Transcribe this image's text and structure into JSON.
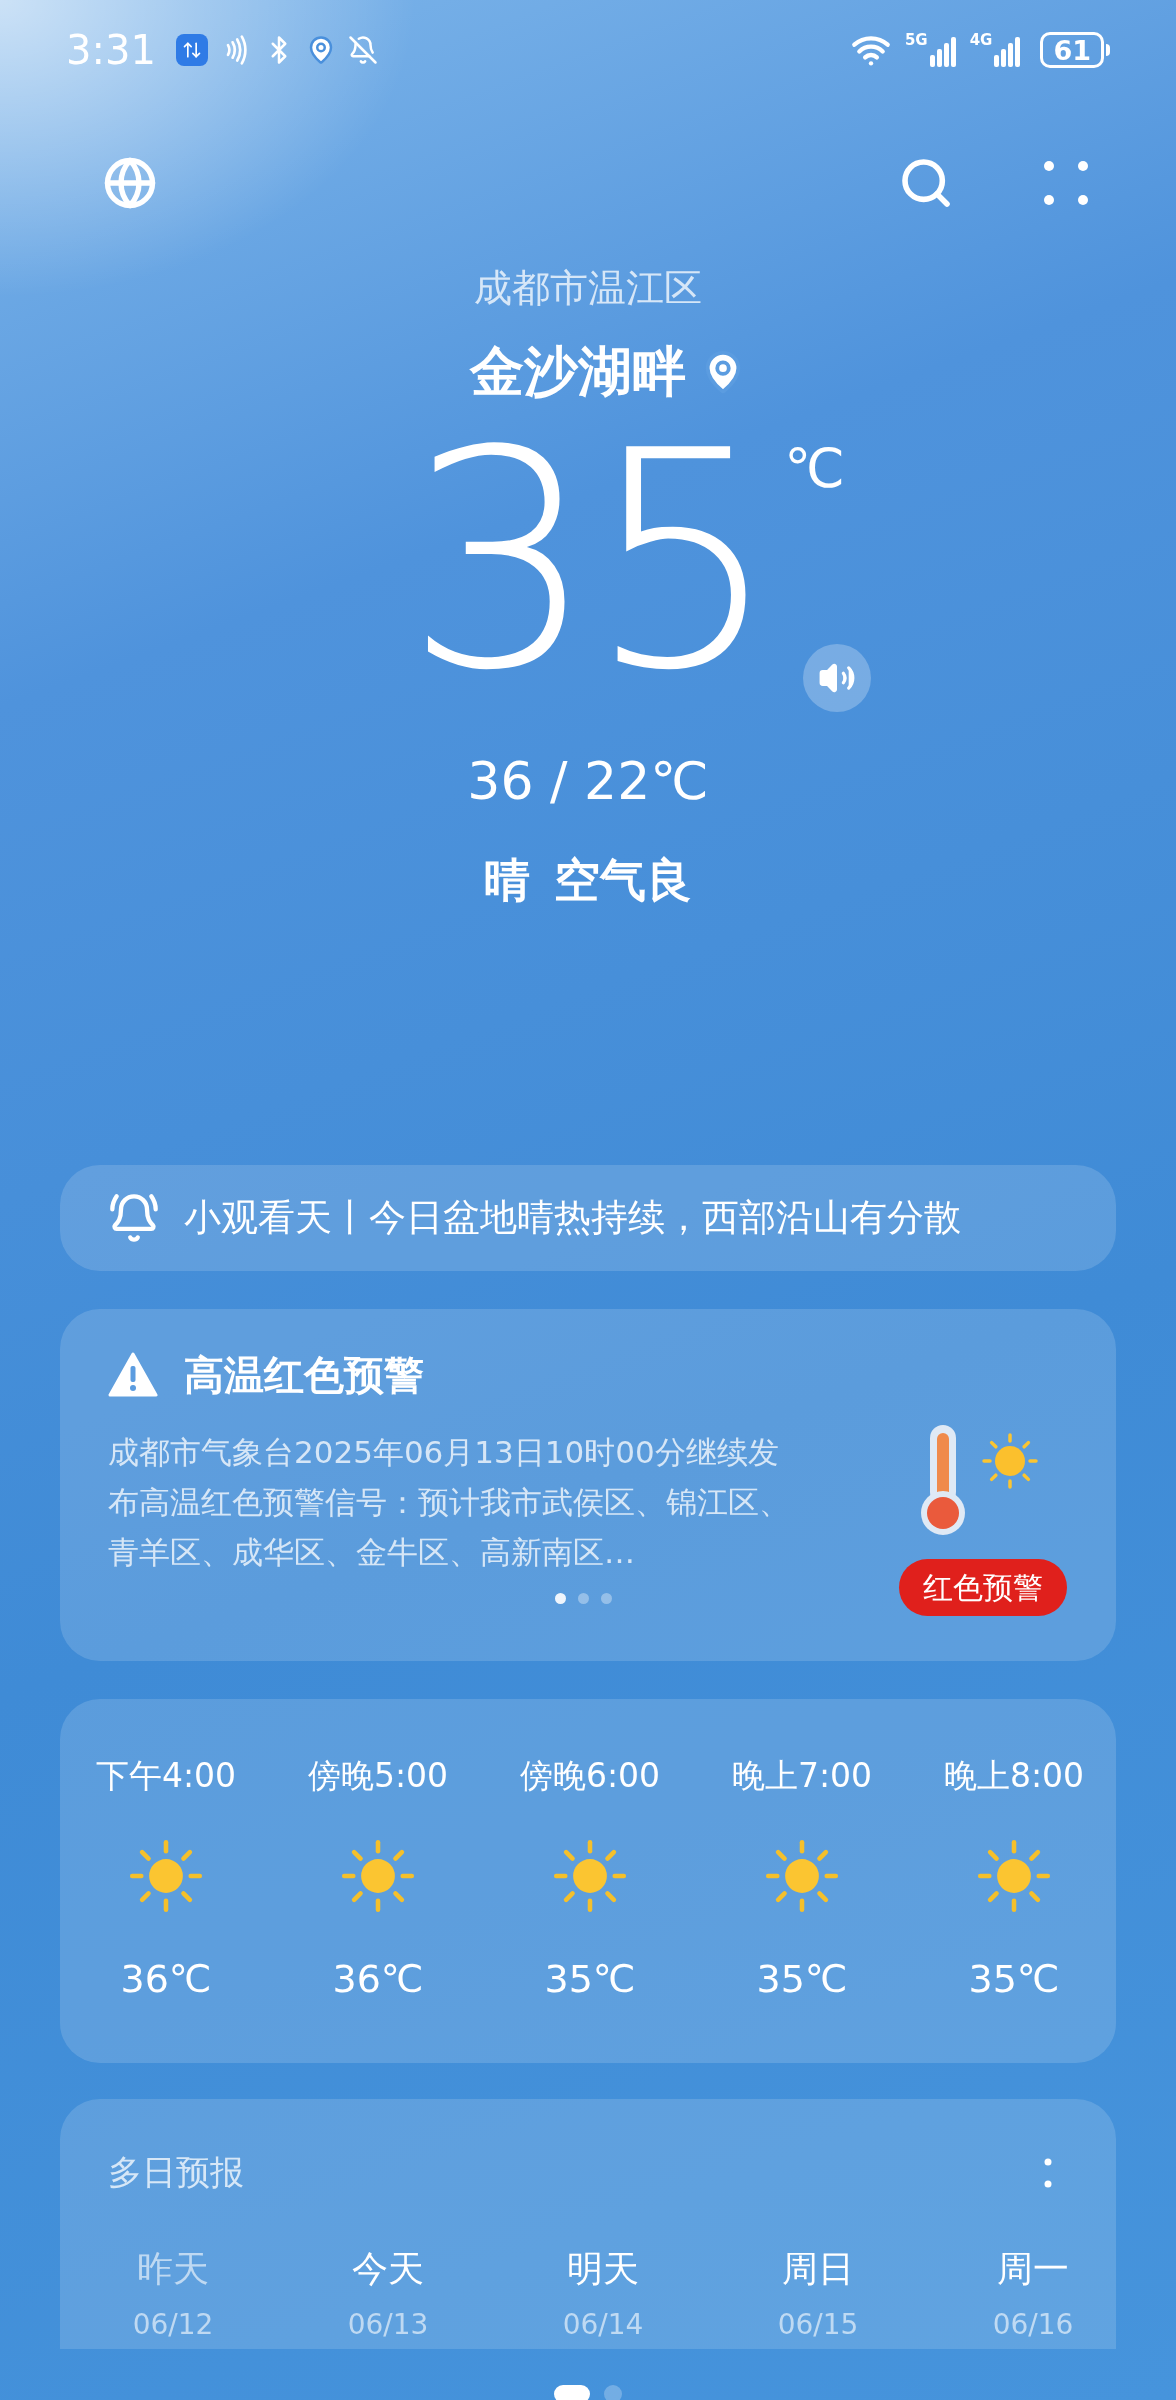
{
  "status_bar": {
    "time": "3:31",
    "networks": [
      "5G",
      "4G"
    ],
    "battery": "61"
  },
  "header": {
    "region": "成都市温江区",
    "location": "金沙湖畔",
    "temperature": "35",
    "unit": "℃",
    "range": "36 / 22℃",
    "condition": "晴",
    "air": "空气良"
  },
  "banner": {
    "text": "小观看天丨今日盆地晴热持续，西部沿山有分散"
  },
  "alert": {
    "title": "高温红色预警",
    "body": "成都市气象台2025年06月13日10时00分继续发布高温红色预警信号：预计我市武侯区、锦江区、青羊区、成华区、金牛区、高新南区…",
    "badge": "红色预警",
    "pages": [
      {
        "selected": true
      },
      {
        "selected": false
      },
      {
        "selected": false
      }
    ]
  },
  "hourly": [
    {
      "time": "下午4:00",
      "temp": "36℃"
    },
    {
      "time": "傍晚5:00",
      "temp": "36℃"
    },
    {
      "time": "傍晚6:00",
      "temp": "35℃"
    },
    {
      "time": "晚上7:00",
      "temp": "35℃"
    },
    {
      "time": "晚上8:00",
      "temp": "35℃"
    }
  ],
  "forecast": {
    "title": "多日预报",
    "days": [
      {
        "label": "昨天",
        "date": "06/12",
        "past": true
      },
      {
        "label": "今天",
        "date": "06/13",
        "past": false
      },
      {
        "label": "明天",
        "date": "06/14",
        "past": false
      },
      {
        "label": "周日",
        "date": "06/15",
        "past": false
      },
      {
        "label": "周一",
        "date": "06/16",
        "past": false
      }
    ]
  },
  "page_indicator": [
    {
      "selected": true
    },
    {
      "selected": false
    }
  ]
}
